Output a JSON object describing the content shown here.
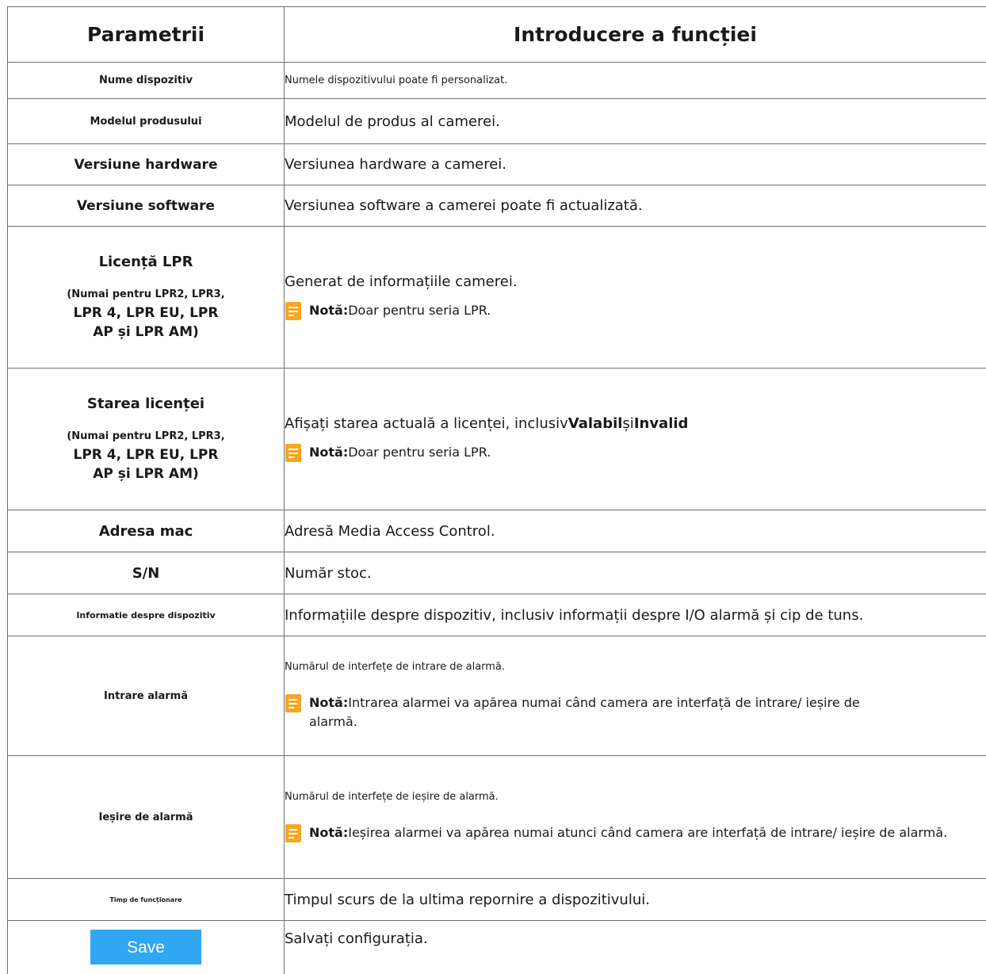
{
  "header": {
    "col1": "Parametrii",
    "col2": "Introducere a funcției"
  },
  "rows": {
    "device_name": {
      "param": "Nume dispozitiv",
      "desc": "Numele dispozitivului poate fi personalizat."
    },
    "product_model": {
      "param": "Modelul produsului",
      "desc": "Modelul de produs al camerei."
    },
    "hw_version": {
      "param": "Versiune hardware",
      "desc": "Versiunea hardware a camerei."
    },
    "sw_version": {
      "param": "Versiune software",
      "desc": "Versiunea software a camerei poate fi actualizată."
    },
    "lpr_license": {
      "param": "Licență LPR",
      "sub1": "(Numai pentru LPR2, LPR3,",
      "sub2": "LPR 4, LPR EU, LPR",
      "sub3": "AP și LPR AM)",
      "desc": "Generat de informațiile camerei.",
      "note_label": "Notă:",
      "note_text": "Doar pentru seria LPR."
    },
    "license_status": {
      "param": "Starea licenței",
      "sub1": "(Numai pentru LPR2, LPR3,",
      "sub2": "LPR 4, LPR EU, LPR",
      "sub3": "AP și LPR AM)",
      "desc_pre": "Afișați starea actuală a licenței, inclusiv",
      "desc_b1": "Valabil",
      "desc_mid": "și",
      "desc_b2": "Invalid",
      "note_label": "Notă:",
      "note_text": "Doar pentru seria LPR."
    },
    "mac": {
      "param": "Adresa mac",
      "desc": "Adresă Media Access Control."
    },
    "sn": {
      "param": "S/N",
      "desc": "Număr stoc."
    },
    "device_info": {
      "param": "Informatie despre dispozitiv",
      "desc": "Informațiile despre dispozitiv, inclusiv informații despre I/O alarmă și cip de tuns."
    },
    "alarm_in": {
      "param": "Intrare alarmă",
      "desc": "Numărul de interfețe de intrare de alarmă.",
      "note_label": "Notă:",
      "note_text": "Intrarea alarmei va apărea numai când camera are interfață de intrare/ ieșire de alarmă."
    },
    "alarm_out": {
      "param": "Ieșire de alarmă",
      "desc": "Numărul de interfețe de ieșire de alarmă.",
      "note_label": "Notă:",
      "note_text": "Ieșirea alarmei va apărea numai atunci când camera are interfață de intrare/ ieșire de alarmă."
    },
    "uptime": {
      "param": "Timp de funcționare",
      "desc": "Timpul scurs de la ultima repornire a dispozitivului."
    },
    "save": {
      "button_label": "Save",
      "desc": "Salvați configurația."
    }
  },
  "colors": {
    "save_button": "#2fa7f3",
    "note_icon": "#f5a623",
    "border": "#6f6f6f"
  },
  "icons": {
    "note": "note-icon"
  }
}
